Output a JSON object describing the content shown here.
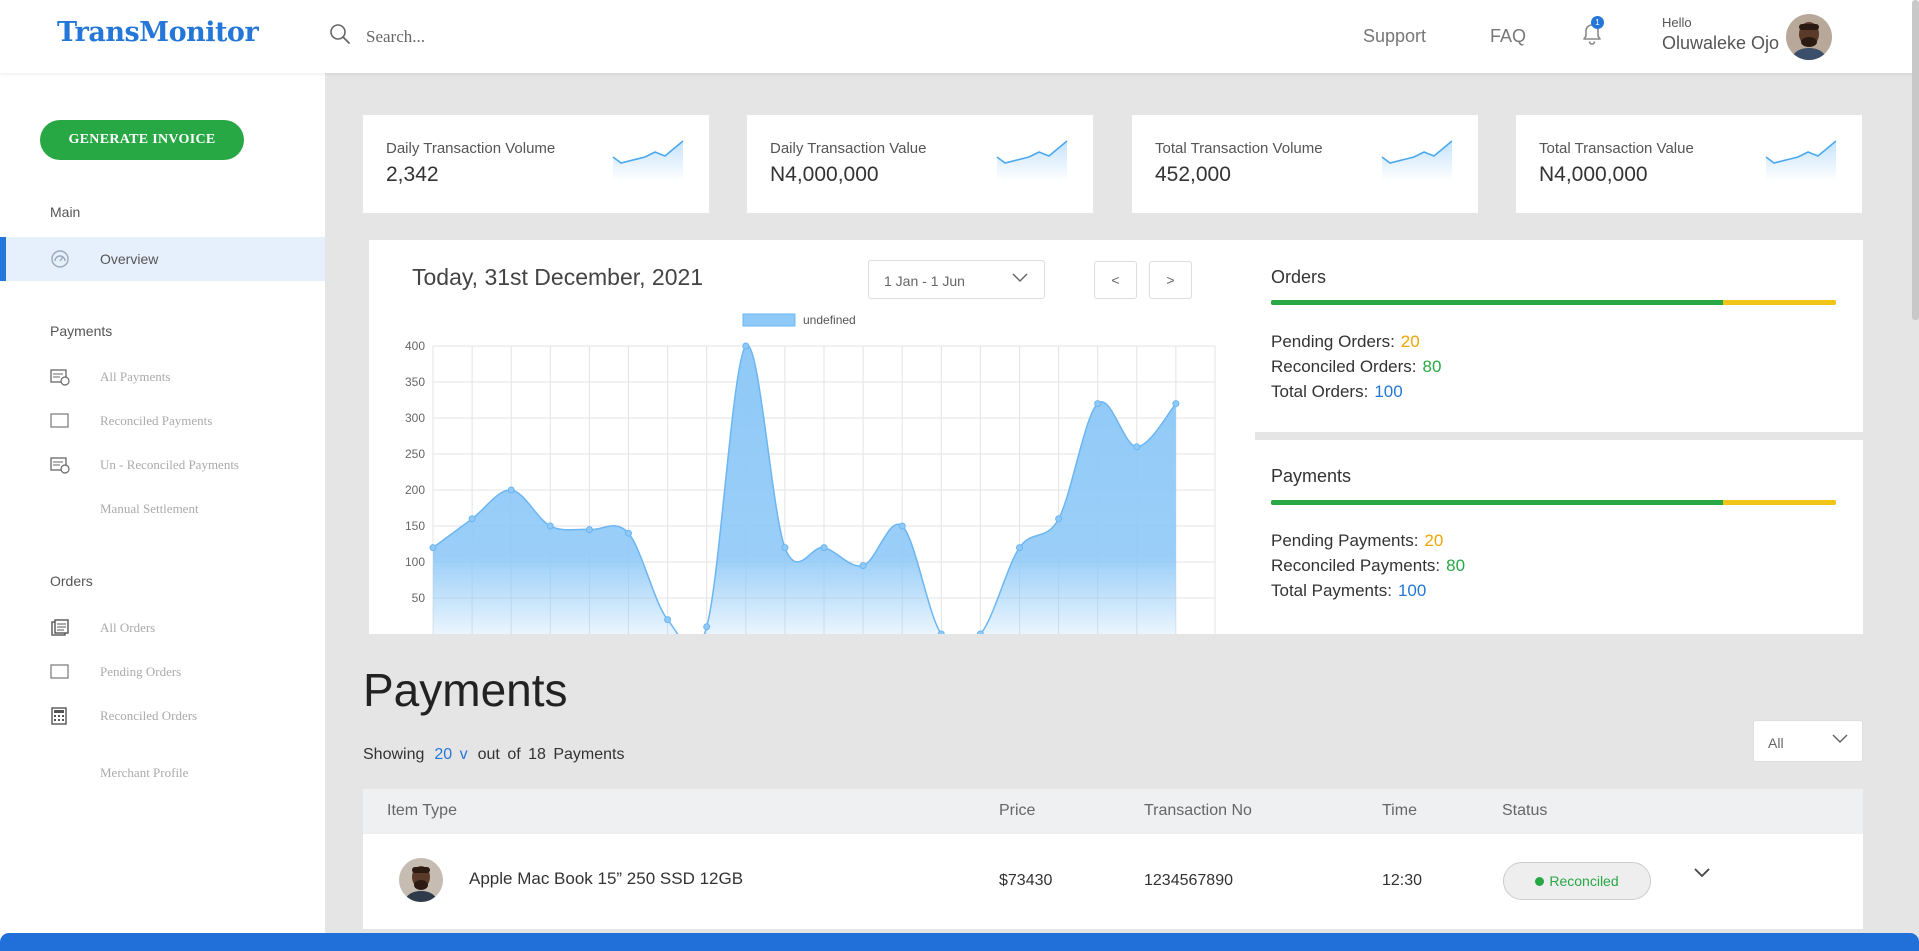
{
  "header": {
    "logo": "TransMonitor",
    "search_placeholder": "Search...",
    "links": [
      "Support",
      "FAQ"
    ],
    "notification_count": "1",
    "greeting": "Hello",
    "user_name": "Oluwaleke Ojo"
  },
  "sidebar": {
    "generate_invoice": "GENERATE INVOICE",
    "sections": {
      "main": {
        "label": "Main",
        "items": [
          {
            "label": "Overview",
            "icon": "dashboard-gauge-icon"
          }
        ]
      },
      "payments": {
        "label": "Payments",
        "items": [
          {
            "label": "All Payments",
            "icon": "receipt-icon"
          },
          {
            "label": "Reconciled Payments",
            "icon": "square-outline-icon"
          },
          {
            "label": "Un - Reconciled Payments",
            "icon": "receipt-icon"
          },
          {
            "label": "Manual Settlement",
            "icon": ""
          }
        ]
      },
      "orders": {
        "label": "Orders",
        "items": [
          {
            "label": "All Orders",
            "icon": "orders-stack-icon"
          },
          {
            "label": "Pending Orders",
            "icon": "square-outline-icon"
          },
          {
            "label": "Reconciled Orders",
            "icon": "calculator-icon"
          }
        ]
      },
      "merchant": {
        "label": "Merchant Profile"
      }
    }
  },
  "stats": [
    {
      "label": "Daily Transaction Volume",
      "value": "2,342"
    },
    {
      "label": "Daily Transaction Value",
      "value": "N4,000,000"
    },
    {
      "label": "Total Transaction Volume",
      "value": "452,000"
    },
    {
      "label": "Total Transaction Value",
      "value": "N4,000,000"
    }
  ],
  "chart_panel": {
    "title": "Today, 31st December, 2021",
    "range": "1 Jan - 1 Jun",
    "prev": "<",
    "next": ">"
  },
  "chart_data": {
    "type": "area",
    "legend": "undefined",
    "ylim": [
      0,
      400
    ],
    "yticks": [
      50,
      100,
      150,
      200,
      250,
      300,
      350,
      400
    ],
    "x": [
      0,
      1,
      2,
      3,
      4,
      5,
      6,
      7,
      8,
      9,
      10,
      11,
      12,
      13,
      14,
      15,
      16,
      17,
      18,
      19,
      20
    ],
    "values": [
      120,
      160,
      200,
      150,
      145,
      140,
      20,
      10,
      400,
      120,
      120,
      95,
      150,
      0,
      0,
      120,
      160,
      320,
      260,
      320,
      null
    ],
    "grid": true,
    "fill_color": "#8fc9f7",
    "line_color": "#6cb6f2"
  },
  "orders": {
    "title": "Orders",
    "progress": 0.8,
    "pending_label": "Pending Orders:",
    "pending": "20",
    "reconciled_label": "Reconciled Orders:",
    "reconciled": "80",
    "total_label": "Total Orders:",
    "total": "100"
  },
  "payments_summary": {
    "title": "Payments",
    "progress": 0.8,
    "pending_label": "Pending Payments:",
    "pending": "20",
    "reconciled_label": "Reconciled Payments:",
    "reconciled": "80",
    "total_label": "Total Payments:",
    "total": "100"
  },
  "payments_table": {
    "heading": "Payments",
    "showing_label": "Showing",
    "page_size": "20 v",
    "out_of": "out of",
    "total": "18",
    "unit": "Payments",
    "filter": "All",
    "columns": [
      "Item Type",
      "Price",
      "Transaction No",
      "Time",
      "Status"
    ],
    "rows": [
      {
        "item": "Apple Mac Book 15” 250 SSD 12GB",
        "price": "$73430",
        "txn": "1234567890",
        "time": "12:30",
        "status": "Reconciled"
      }
    ]
  },
  "colors": {
    "brand": "#2477d8",
    "success": "#28a745",
    "warning": "#f0c419"
  }
}
